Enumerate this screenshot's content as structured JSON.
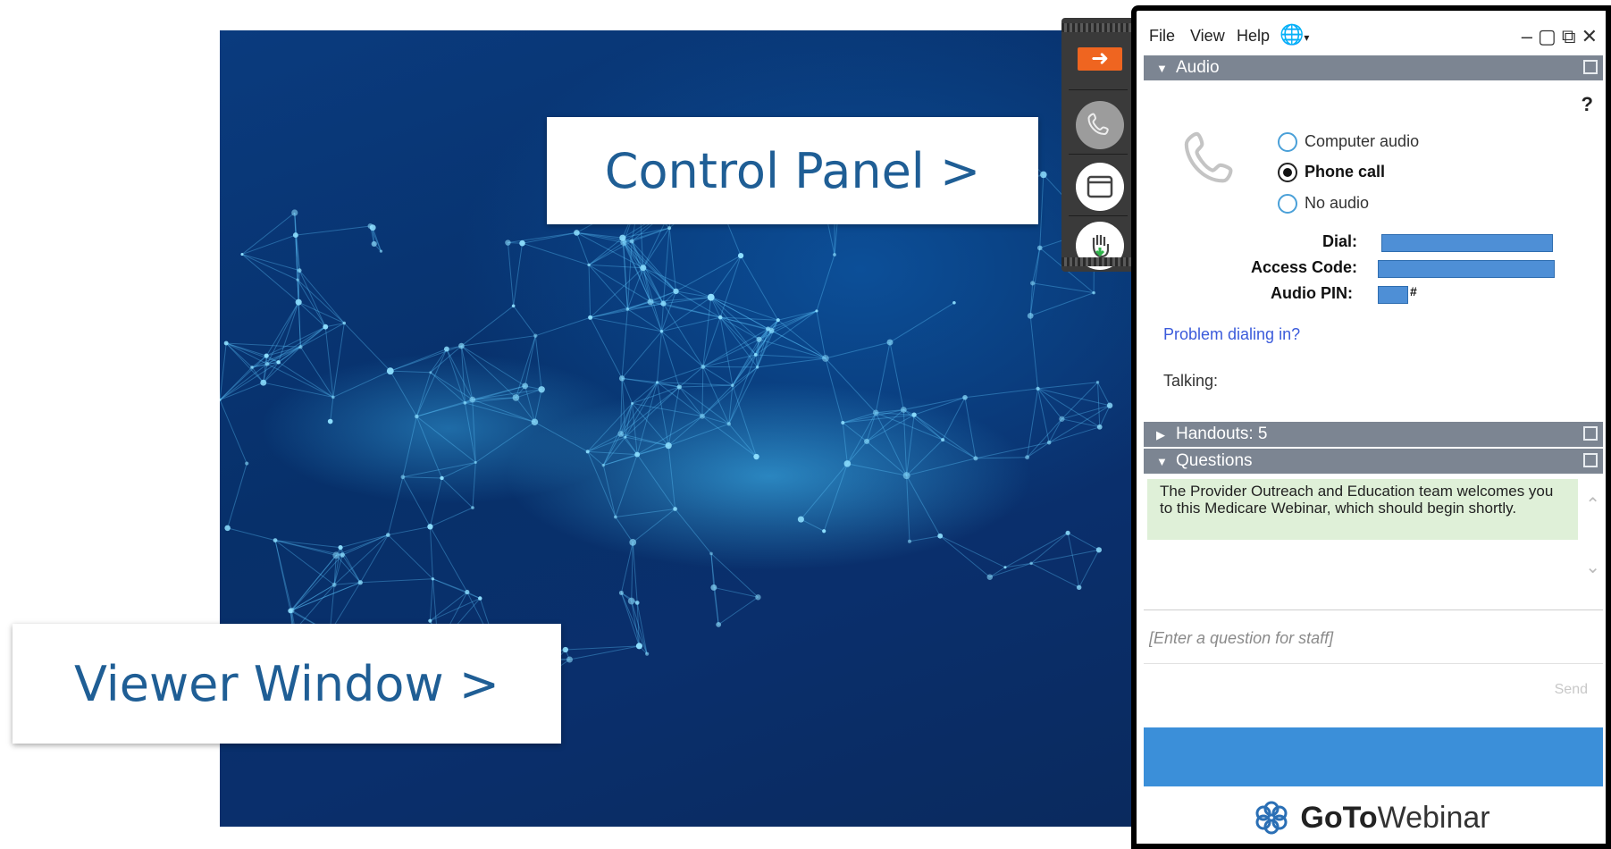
{
  "callouts": {
    "control_panel": "Control Panel >",
    "viewer_window": "Viewer Window >"
  },
  "grabber": {
    "icons": [
      "arrow-right-icon",
      "phone-icon",
      "screen-icon",
      "raise-hand-icon"
    ],
    "accent": "#ef6520"
  },
  "menubar": {
    "items": [
      "File",
      "View",
      "Help"
    ],
    "language_icon": "globe-icon",
    "window_controls": [
      "minimize-icon",
      "restore-icon",
      "popout-icon",
      "close-icon"
    ]
  },
  "audio": {
    "section_label": "Audio",
    "help": "?",
    "options": [
      {
        "label": "Computer audio",
        "selected": false
      },
      {
        "label": "Phone call",
        "selected": true
      },
      {
        "label": "No audio",
        "selected": false
      }
    ],
    "dial_label": "Dial:",
    "access_code_label": "Access Code:",
    "audio_pin_label": "Audio PIN:",
    "pin_suffix": "#",
    "problem_link": "Problem dialing in?",
    "talking_label": "Talking:"
  },
  "handouts": {
    "section_label": "Handouts: 5"
  },
  "questions": {
    "section_label": "Questions",
    "message": "The Provider Outreach and Education team welcomes you to this Medicare Webinar, which should begin shortly.",
    "input_placeholder": "[Enter a question for staff]",
    "send_label": "Send"
  },
  "brand": {
    "goto": "GoTo",
    "webinar": "Webinar"
  },
  "colors": {
    "section_bar": "#7c8592",
    "blue_band": "#3b8fd9",
    "callout_text": "#1f5e95",
    "message_bg": "#dff0d8"
  }
}
